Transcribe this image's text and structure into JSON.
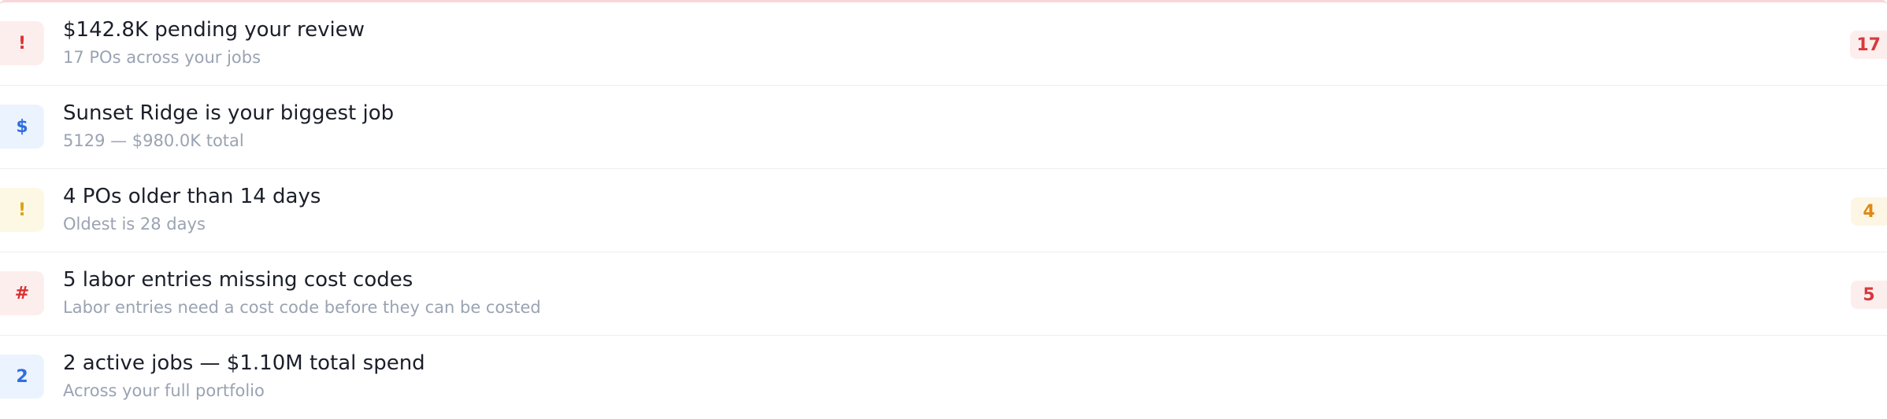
{
  "insights": [
    {
      "icon": "!",
      "icon_name": "alert-icon",
      "title": "$142.8K pending your review",
      "subtitle": "17 POs across your jobs",
      "badge": "17"
    },
    {
      "icon": "$",
      "icon_name": "dollar-icon",
      "title": "Sunset Ridge is your biggest job",
      "subtitle": "5129 — $980.0K total",
      "badge": ""
    },
    {
      "icon": "!",
      "icon_name": "alert-icon",
      "title": "4 POs older than 14 days",
      "subtitle": "Oldest is 28 days",
      "badge": "4"
    },
    {
      "icon": "#",
      "icon_name": "hash-icon",
      "title": "5 labor entries missing cost codes",
      "subtitle": "Labor entries need a cost code before they can be costed",
      "badge": "5"
    },
    {
      "icon": "2",
      "icon_name": "count-icon",
      "title": "2 active jobs — $1.10M total spend",
      "subtitle": "Across your full portfolio",
      "badge": ""
    }
  ],
  "colors": {
    "red": "#dc3030",
    "blue": "#2f6ee0",
    "yellow": "#d9a216",
    "orange": "#df8a13",
    "muted_text": "#9aa3b2",
    "title_text": "#1b1f2a"
  }
}
